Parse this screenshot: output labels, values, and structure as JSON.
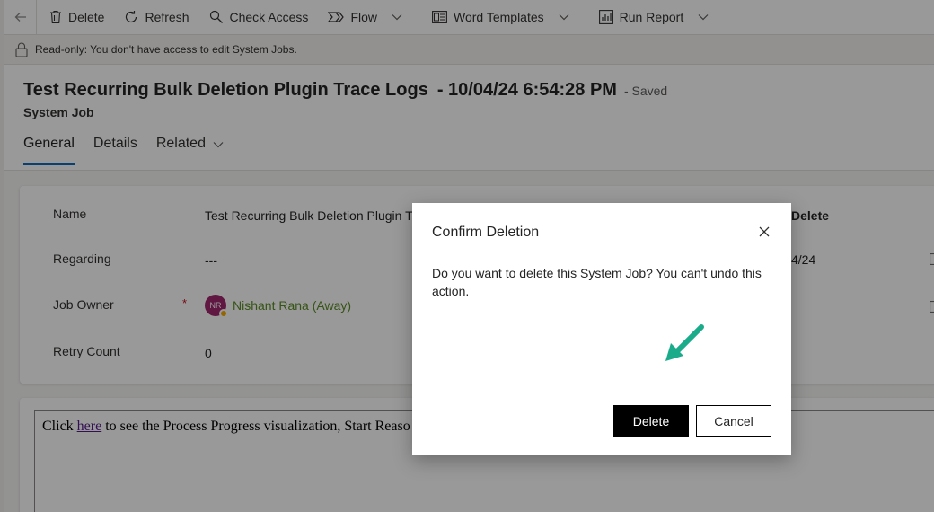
{
  "command_bar": {
    "items": [
      {
        "label": "Delete",
        "icon": "trash-icon"
      },
      {
        "label": "Refresh",
        "icon": "refresh-icon"
      },
      {
        "label": "Check Access",
        "icon": "check-access-icon"
      },
      {
        "label": "Flow",
        "icon": "flow-icon"
      },
      {
        "label": "Word Templates",
        "icon": "word-templates-icon"
      },
      {
        "label": "Run Report",
        "icon": "run-report-icon"
      }
    ]
  },
  "banner": {
    "text": "Read-only: You don't have access to edit System Jobs."
  },
  "header": {
    "title": "Test Recurring Bulk Deletion Plugin Trace Logs",
    "title_date": "- 10/04/24 6:54:28 PM",
    "status": "- Saved",
    "entity": "System Job"
  },
  "tabs": [
    {
      "label": "General"
    },
    {
      "label": "Details"
    },
    {
      "label": "Related"
    }
  ],
  "form": {
    "name_label": "Name",
    "name_value": "Test Recurring Bulk Deletion Plugin Tr",
    "regarding_label": "Regarding",
    "regarding_value": "---",
    "owner_label": "Job Owner",
    "required_mark": "*",
    "owner_initials": "NR",
    "owner_name": "Nishant Rana (Away)",
    "retry_label": "Retry Count",
    "retry_value": "0",
    "right_value_1": "Delete",
    "right_value_2": "4/24"
  },
  "web_resource": {
    "prefix": "Click",
    "link_text": "here",
    "suffix": "to see the Process Progress visualization, Start Reaso"
  },
  "dialog": {
    "title": "Confirm Deletion",
    "message": "Do you want to delete this System Job? You can't undo this action.",
    "delete_label": "Delete",
    "cancel_label": "Cancel"
  },
  "colors": {
    "accent": "#0f6cbd",
    "arrow": "#1aab8b",
    "owner_link": "#5b8c24",
    "avatar": "#a1276f",
    "presence_away": "#f8a800"
  }
}
